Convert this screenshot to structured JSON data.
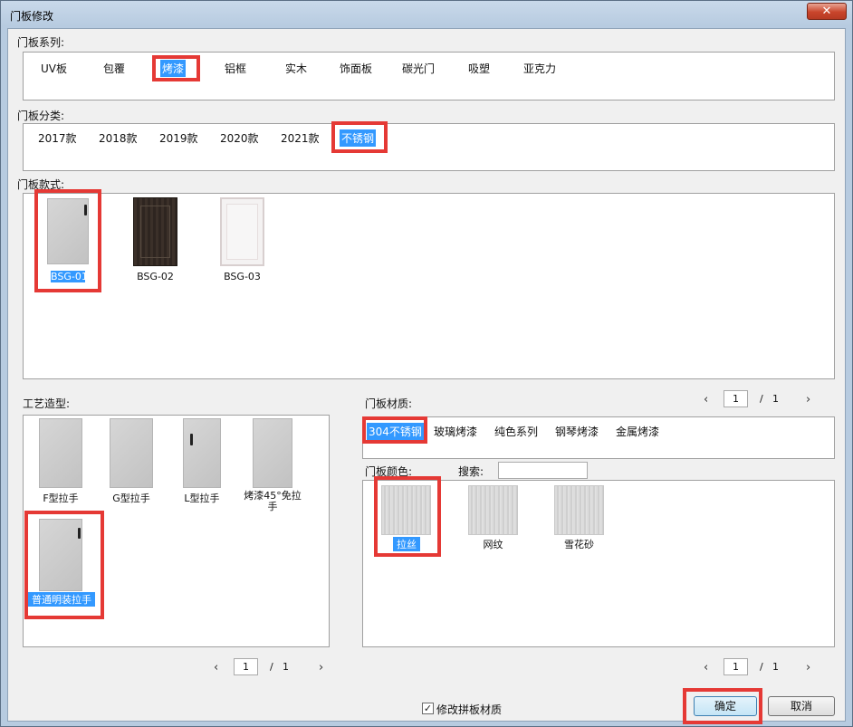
{
  "window": {
    "title": "门板修改",
    "close_glyph": "✕"
  },
  "series": {
    "label": "门板系列:",
    "items": [
      "UV板",
      "包覆",
      "烤漆",
      "铝框",
      "实木",
      "饰面板",
      "碳光门",
      "吸塑",
      "亚克力"
    ],
    "selected": "烤漆"
  },
  "category": {
    "label": "门板分类:",
    "items": [
      "2017款",
      "2018款",
      "2019款",
      "2020款",
      "2021款",
      "不锈钢"
    ],
    "selected": "不锈钢"
  },
  "styles": {
    "label": "门板款式:",
    "items": [
      "BSG-01",
      "BSG-02",
      "BSG-03"
    ],
    "selected": "BSG-01"
  },
  "craft": {
    "label": "工艺造型:",
    "items": [
      "F型拉手",
      "G型拉手",
      "L型拉手",
      "烤漆45°免拉手",
      "普通明装拉手"
    ],
    "selected": "普通明装拉手",
    "pager": {
      "prev": "‹",
      "page": "1",
      "slash": "/",
      "total": "1",
      "next": "›"
    }
  },
  "material": {
    "label": "门板材质:",
    "items": [
      "304不锈钢",
      "玻璃烤漆",
      "纯色系列",
      "钢琴烤漆",
      "金属烤漆"
    ],
    "selected": "304不锈钢",
    "pager": {
      "prev": "‹",
      "page": "1",
      "slash": "/",
      "total": "1",
      "next": "›"
    }
  },
  "color": {
    "label": "门板颜色:",
    "search_label": "搜索:",
    "search_value": "",
    "items": [
      "拉丝",
      "网纹",
      "雪花砂"
    ],
    "selected": "拉丝",
    "pager": {
      "prev": "‹",
      "page": "1",
      "slash": "/",
      "total": "1",
      "next": "›"
    }
  },
  "footer": {
    "checkbox_label": "修改拼板材质",
    "checkbox_checked": true,
    "check_glyph": "✓",
    "ok_label": "确定",
    "cancel_label": "取消"
  },
  "colors": {
    "selection": "#3399ff",
    "highlight": "#e53935"
  }
}
